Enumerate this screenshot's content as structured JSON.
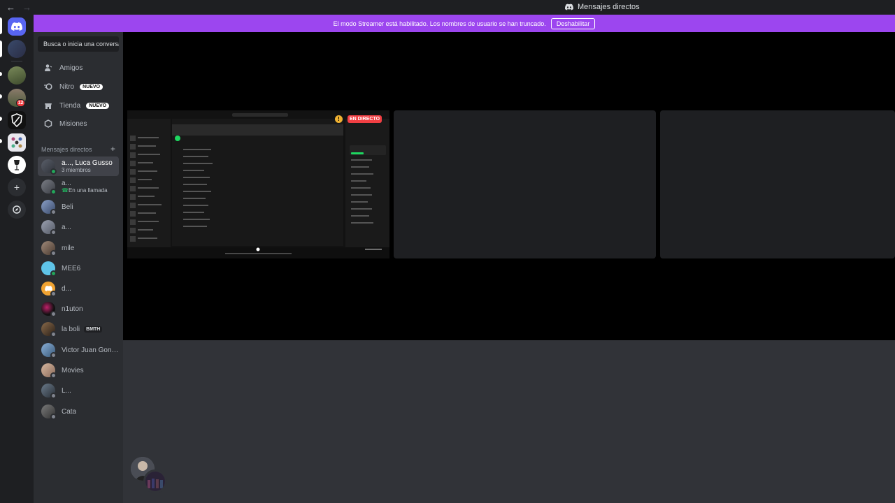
{
  "titlebar": {
    "title": "Mensajes directos",
    "back": "←",
    "forward": "→"
  },
  "banner": {
    "text": "El modo Streamer está habilitado. Los nombres de usuario se han truncado.",
    "button": "Deshabilitar",
    "color": "#9c46ef"
  },
  "guilds": {
    "badge_count": "12"
  },
  "sidebar": {
    "search_placeholder": "Busca o inicia una conversación",
    "nav": [
      {
        "label": "Amigos",
        "icon": "friends-icon"
      },
      {
        "label": "Nitro",
        "icon": "nitro-icon",
        "tag": "NUEVO"
      },
      {
        "label": "Tienda",
        "icon": "shop-icon",
        "tag": "NUEVO"
      },
      {
        "label": "Misiones",
        "icon": "quests-icon"
      }
    ],
    "dm_header": "Mensajes directos",
    "dms": [
      {
        "name": "a..., Luca Gusso",
        "sub": "3 miembros"
      },
      {
        "name": "a...",
        "sub": "En una llamada"
      },
      {
        "name": "Beli"
      },
      {
        "name": "a..."
      },
      {
        "name": "mile"
      },
      {
        "name": "MEE6"
      },
      {
        "name": "d..."
      },
      {
        "name": "n1uton"
      },
      {
        "name": "la boli",
        "badge": "BMTH"
      },
      {
        "name": "Victor Juan Gonzalez"
      },
      {
        "name": "Movies"
      },
      {
        "name": "L..."
      },
      {
        "name": "Cata"
      }
    ]
  },
  "stage": {
    "live_label": "EN DIRECTO",
    "warning": "!"
  }
}
